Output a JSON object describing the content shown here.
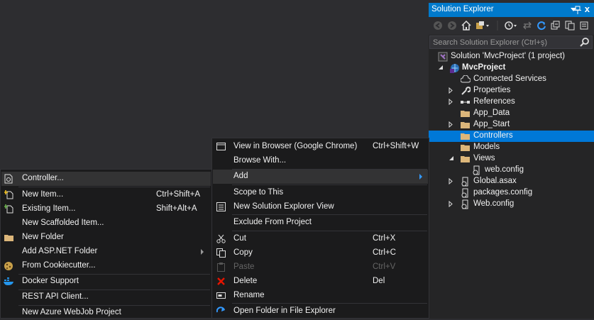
{
  "solution_explorer": {
    "title": "Solution Explorer",
    "close_glyph": "x",
    "search_placeholder": "Search Solution Explorer (Ctrl+ş)",
    "toolbar_icons": [
      "back-icon",
      "forward-icon",
      "home-icon",
      "switch-views-icon",
      "pending-changes-icon",
      "sync-icon",
      "refresh-icon",
      "collapse-all-icon",
      "show-all-files-icon"
    ],
    "tree": [
      {
        "label": "Solution 'MvcProject' (1 project)",
        "icon": "solution-icon"
      },
      {
        "label": "MvcProject",
        "icon": "web-project-icon",
        "bold": true
      },
      {
        "label": "Connected Services",
        "icon": "cloud-icon"
      },
      {
        "label": "Properties",
        "icon": "wrench-icon"
      },
      {
        "label": "References",
        "icon": "references-icon"
      },
      {
        "label": "App_Data",
        "icon": "folder-icon"
      },
      {
        "label": "App_Start",
        "icon": "folder-icon"
      },
      {
        "label": "Controllers",
        "icon": "folder-icon",
        "selected": true
      },
      {
        "label": "Models",
        "icon": "folder-icon"
      },
      {
        "label": "Views",
        "icon": "folder-icon"
      },
      {
        "label": "web.config",
        "icon": "config-file-icon"
      },
      {
        "label": "Global.asax",
        "icon": "asax-file-icon"
      },
      {
        "label": "packages.config",
        "icon": "config-file-icon"
      },
      {
        "label": "Web.config",
        "icon": "config-file-icon"
      }
    ]
  },
  "context_menu": {
    "items": [
      {
        "label": "View in Browser (Google Chrome)",
        "shortcut": "Ctrl+Shift+W",
        "icon": "browser-icon"
      },
      {
        "label": "Browse With...",
        "shortcut": ""
      },
      {
        "label": "Add",
        "shortcut": "",
        "has_submenu": true,
        "highlighted": true
      },
      {
        "label": "Scope to This",
        "shortcut": ""
      },
      {
        "label": "New Solution Explorer View",
        "shortcut": "",
        "icon": "new-view-icon"
      },
      {
        "label": "Exclude From Project",
        "shortcut": ""
      },
      {
        "label": "Cut",
        "shortcut": "Ctrl+X",
        "icon": "scissors-icon"
      },
      {
        "label": "Copy",
        "shortcut": "Ctrl+C",
        "icon": "copy-icon"
      },
      {
        "label": "Paste",
        "shortcut": "Ctrl+V",
        "icon": "paste-icon",
        "disabled": true
      },
      {
        "label": "Delete",
        "shortcut": "Del",
        "icon": "delete-x-icon"
      },
      {
        "label": "Rename",
        "shortcut": "",
        "icon": "rename-icon"
      },
      {
        "label": "Open Folder in File Explorer",
        "shortcut": "",
        "icon": "open-folder-icon"
      }
    ]
  },
  "add_submenu": {
    "items": [
      {
        "label": "Controller...",
        "shortcut": "",
        "icon": "controller-icon",
        "highlighted": true
      },
      {
        "label": "New Item...",
        "shortcut": "Ctrl+Shift+A",
        "icon": "new-item-icon"
      },
      {
        "label": "Existing Item...",
        "shortcut": "Shift+Alt+A",
        "icon": "existing-item-icon"
      },
      {
        "label": "New Scaffolded Item...",
        "shortcut": ""
      },
      {
        "label": "New Folder",
        "shortcut": "",
        "icon": "new-folder-icon"
      },
      {
        "label": "Add ASP.NET Folder",
        "shortcut": "",
        "has_submenu": true
      },
      {
        "label": "From Cookiecutter...",
        "shortcut": "",
        "icon": "cookiecutter-icon"
      },
      {
        "label": "Docker Support",
        "shortcut": "",
        "icon": "docker-icon"
      },
      {
        "label": "REST API Client...",
        "shortcut": ""
      },
      {
        "label": "New Azure WebJob Project",
        "shortcut": ""
      }
    ]
  },
  "colors": {
    "accent": "#007acc",
    "selection": "#0078d7",
    "menu_bg": "#1b1b1c",
    "editor_bg": "#2d2d30",
    "panel_bg": "#252526"
  }
}
